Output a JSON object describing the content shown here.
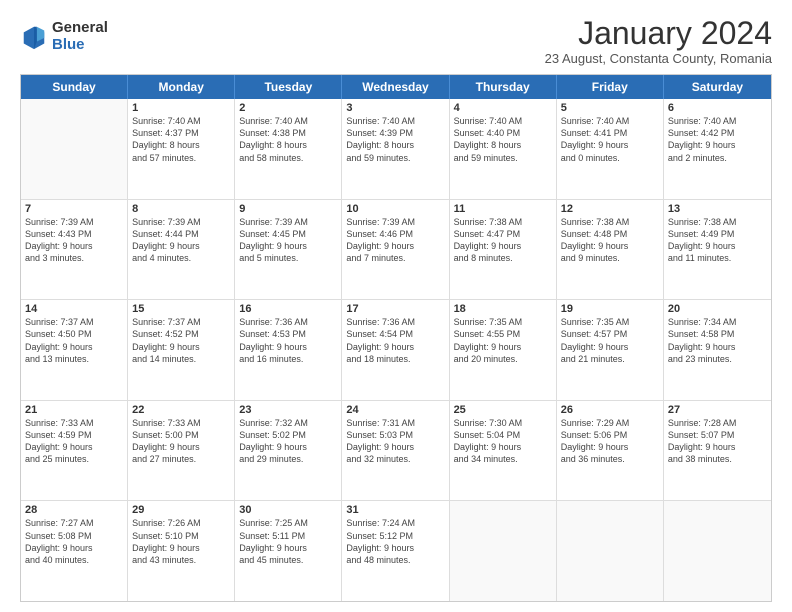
{
  "header": {
    "logo_general": "General",
    "logo_blue": "Blue",
    "title": "January 2024",
    "subtitle": "23 August, Constanta County, Romania"
  },
  "days": [
    "Sunday",
    "Monday",
    "Tuesday",
    "Wednesday",
    "Thursday",
    "Friday",
    "Saturday"
  ],
  "weeks": [
    [
      {
        "day": "",
        "info": ""
      },
      {
        "day": "1",
        "info": "Sunrise: 7:40 AM\nSunset: 4:37 PM\nDaylight: 8 hours\nand 57 minutes."
      },
      {
        "day": "2",
        "info": "Sunrise: 7:40 AM\nSunset: 4:38 PM\nDaylight: 8 hours\nand 58 minutes."
      },
      {
        "day": "3",
        "info": "Sunrise: 7:40 AM\nSunset: 4:39 PM\nDaylight: 8 hours\nand 59 minutes."
      },
      {
        "day": "4",
        "info": "Sunrise: 7:40 AM\nSunset: 4:40 PM\nDaylight: 8 hours\nand 59 minutes."
      },
      {
        "day": "5",
        "info": "Sunrise: 7:40 AM\nSunset: 4:41 PM\nDaylight: 9 hours\nand 0 minutes."
      },
      {
        "day": "6",
        "info": "Sunrise: 7:40 AM\nSunset: 4:42 PM\nDaylight: 9 hours\nand 2 minutes."
      }
    ],
    [
      {
        "day": "7",
        "info": "Sunrise: 7:39 AM\nSunset: 4:43 PM\nDaylight: 9 hours\nand 3 minutes."
      },
      {
        "day": "8",
        "info": "Sunrise: 7:39 AM\nSunset: 4:44 PM\nDaylight: 9 hours\nand 4 minutes."
      },
      {
        "day": "9",
        "info": "Sunrise: 7:39 AM\nSunset: 4:45 PM\nDaylight: 9 hours\nand 5 minutes."
      },
      {
        "day": "10",
        "info": "Sunrise: 7:39 AM\nSunset: 4:46 PM\nDaylight: 9 hours\nand 7 minutes."
      },
      {
        "day": "11",
        "info": "Sunrise: 7:38 AM\nSunset: 4:47 PM\nDaylight: 9 hours\nand 8 minutes."
      },
      {
        "day": "12",
        "info": "Sunrise: 7:38 AM\nSunset: 4:48 PM\nDaylight: 9 hours\nand 9 minutes."
      },
      {
        "day": "13",
        "info": "Sunrise: 7:38 AM\nSunset: 4:49 PM\nDaylight: 9 hours\nand 11 minutes."
      }
    ],
    [
      {
        "day": "14",
        "info": "Sunrise: 7:37 AM\nSunset: 4:50 PM\nDaylight: 9 hours\nand 13 minutes."
      },
      {
        "day": "15",
        "info": "Sunrise: 7:37 AM\nSunset: 4:52 PM\nDaylight: 9 hours\nand 14 minutes."
      },
      {
        "day": "16",
        "info": "Sunrise: 7:36 AM\nSunset: 4:53 PM\nDaylight: 9 hours\nand 16 minutes."
      },
      {
        "day": "17",
        "info": "Sunrise: 7:36 AM\nSunset: 4:54 PM\nDaylight: 9 hours\nand 18 minutes."
      },
      {
        "day": "18",
        "info": "Sunrise: 7:35 AM\nSunset: 4:55 PM\nDaylight: 9 hours\nand 20 minutes."
      },
      {
        "day": "19",
        "info": "Sunrise: 7:35 AM\nSunset: 4:57 PM\nDaylight: 9 hours\nand 21 minutes."
      },
      {
        "day": "20",
        "info": "Sunrise: 7:34 AM\nSunset: 4:58 PM\nDaylight: 9 hours\nand 23 minutes."
      }
    ],
    [
      {
        "day": "21",
        "info": "Sunrise: 7:33 AM\nSunset: 4:59 PM\nDaylight: 9 hours\nand 25 minutes."
      },
      {
        "day": "22",
        "info": "Sunrise: 7:33 AM\nSunset: 5:00 PM\nDaylight: 9 hours\nand 27 minutes."
      },
      {
        "day": "23",
        "info": "Sunrise: 7:32 AM\nSunset: 5:02 PM\nDaylight: 9 hours\nand 29 minutes."
      },
      {
        "day": "24",
        "info": "Sunrise: 7:31 AM\nSunset: 5:03 PM\nDaylight: 9 hours\nand 32 minutes."
      },
      {
        "day": "25",
        "info": "Sunrise: 7:30 AM\nSunset: 5:04 PM\nDaylight: 9 hours\nand 34 minutes."
      },
      {
        "day": "26",
        "info": "Sunrise: 7:29 AM\nSunset: 5:06 PM\nDaylight: 9 hours\nand 36 minutes."
      },
      {
        "day": "27",
        "info": "Sunrise: 7:28 AM\nSunset: 5:07 PM\nDaylight: 9 hours\nand 38 minutes."
      }
    ],
    [
      {
        "day": "28",
        "info": "Sunrise: 7:27 AM\nSunset: 5:08 PM\nDaylight: 9 hours\nand 40 minutes."
      },
      {
        "day": "29",
        "info": "Sunrise: 7:26 AM\nSunset: 5:10 PM\nDaylight: 9 hours\nand 43 minutes."
      },
      {
        "day": "30",
        "info": "Sunrise: 7:25 AM\nSunset: 5:11 PM\nDaylight: 9 hours\nand 45 minutes."
      },
      {
        "day": "31",
        "info": "Sunrise: 7:24 AM\nSunset: 5:12 PM\nDaylight: 9 hours\nand 48 minutes."
      },
      {
        "day": "",
        "info": ""
      },
      {
        "day": "",
        "info": ""
      },
      {
        "day": "",
        "info": ""
      }
    ]
  ]
}
